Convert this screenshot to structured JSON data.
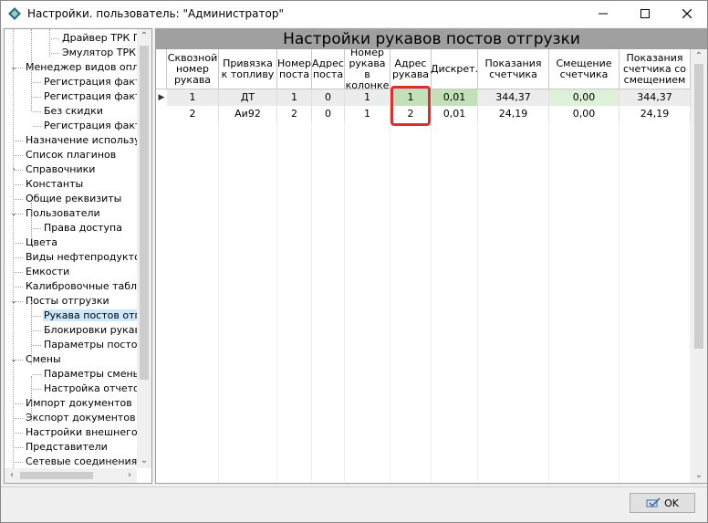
{
  "window": {
    "title": "Настройки. пользователь: \"Администратор\"",
    "minimize_glyph": "—",
    "maximize_glyph": "☐",
    "close_glyph": "✕"
  },
  "tree": {
    "items": [
      {
        "label": "Драйвер ТРК Пр",
        "level": 3,
        "expander": ""
      },
      {
        "label": "Эмулятор ТРК",
        "level": 3,
        "expander": ""
      },
      {
        "label": "Менеджер видов оплат",
        "level": 1,
        "expander": "⌄"
      },
      {
        "label": "Регистрация факта",
        "level": 2,
        "expander": ""
      },
      {
        "label": "Регистрация факта",
        "level": 2,
        "expander": ""
      },
      {
        "label": "Без скидки",
        "level": 2,
        "expander": ""
      },
      {
        "label": "Регистрация факта",
        "level": 2,
        "expander": ""
      },
      {
        "label": "Назначение используем",
        "level": 1,
        "expander": ""
      },
      {
        "label": "Список плагинов",
        "level": 1,
        "expander": ""
      },
      {
        "label": "Справочники",
        "level": 1,
        "expander": "›"
      },
      {
        "label": "Константы",
        "level": 1,
        "expander": ""
      },
      {
        "label": "Общие реквизиты",
        "level": 1,
        "expander": ""
      },
      {
        "label": "Пользователи",
        "level": 1,
        "expander": "⌄"
      },
      {
        "label": "Права доступа",
        "level": 2,
        "expander": ""
      },
      {
        "label": "Цвета",
        "level": 1,
        "expander": ""
      },
      {
        "label": "Виды нефтепродуктов",
        "level": 1,
        "expander": ""
      },
      {
        "label": "Емкости",
        "level": 1,
        "expander": ""
      },
      {
        "label": "Калибровочные таблиц",
        "level": 1,
        "expander": ""
      },
      {
        "label": "Посты отгрузки",
        "level": 1,
        "expander": "⌄"
      },
      {
        "label": "Рукава постов отгр",
        "level": 2,
        "expander": "",
        "selected": true
      },
      {
        "label": "Блокировки рукавов",
        "level": 2,
        "expander": ""
      },
      {
        "label": "Параметры постов с",
        "level": 2,
        "expander": ""
      },
      {
        "label": "Смены",
        "level": 1,
        "expander": "⌄"
      },
      {
        "label": "Параметры смены",
        "level": 2,
        "expander": ""
      },
      {
        "label": "Настройка отчетов",
        "level": 2,
        "expander": ""
      },
      {
        "label": "Импорт документов",
        "level": 1,
        "expander": ""
      },
      {
        "label": "Экспорт документов",
        "level": 1,
        "expander": ""
      },
      {
        "label": "Настройки внешнего ви",
        "level": 1,
        "expander": ""
      },
      {
        "label": "Представители",
        "level": 1,
        "expander": ""
      },
      {
        "label": "Сетевые соединения",
        "level": 1,
        "expander": ""
      }
    ]
  },
  "panel": {
    "title": "Настройки рукавов постов отгрузки",
    "columns": [
      "Сквозной номер рукава",
      "Привязка к топливу",
      "Номер поста",
      "Адрес поста",
      "Номер рукава в колонке",
      "Адрес рукава",
      "Дискрет.",
      "Показания счетчика",
      "Смещение счетчика",
      "Показания счетчика со смещением"
    ],
    "rows": [
      {
        "current": true,
        "cells": [
          "1",
          "ДТ",
          "1",
          "0",
          "1",
          "1",
          "0,01",
          "344,37",
          "0,00",
          "344,37"
        ]
      },
      {
        "current": false,
        "cells": [
          "2",
          "Аи92",
          "2",
          "0",
          "1",
          "2",
          "0,01",
          "24,19",
          "0,00",
          "24,19"
        ]
      }
    ]
  },
  "buttons": {
    "ok_label": "OK"
  },
  "colors": {
    "title_band": "#a0a0a0",
    "highlight": "#d9302c",
    "cell_green": "#c4e0b8",
    "tree_selection": "#cce8ff"
  }
}
